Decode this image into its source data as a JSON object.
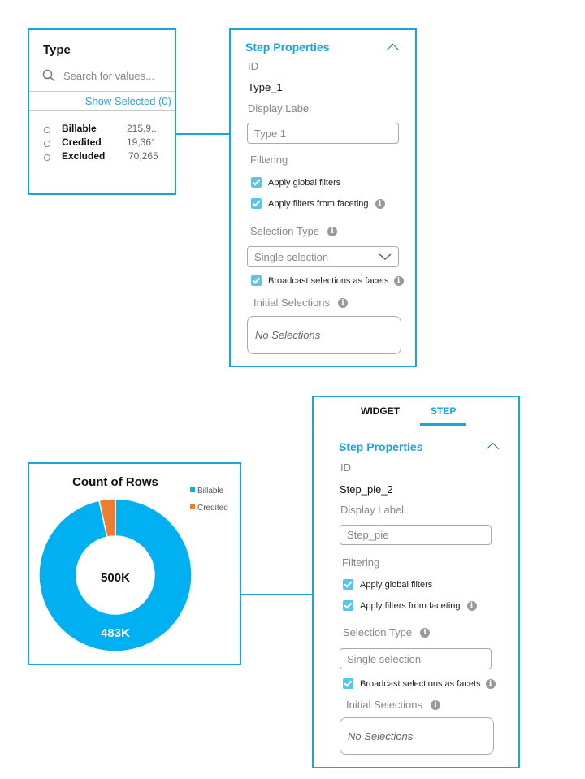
{
  "facet_panel": {
    "title": "Type",
    "search_placeholder": "Search for values...",
    "show_selected": "Show Selected (0)",
    "items": [
      {
        "label": "Billable",
        "count": "215,9..."
      },
      {
        "label": "Credited",
        "count": "19,361"
      },
      {
        "label": "Excluded",
        "count": "70,265"
      }
    ]
  },
  "step_panel_1": {
    "section_title": "Step Properties",
    "id_label": "ID",
    "id_value": "Type_1",
    "display_label_label": "Display Label",
    "display_label_value": "Type 1",
    "filtering_label": "Filtering",
    "apply_global_filters": "Apply global filters",
    "apply_faceting_filters": "Apply filters from faceting",
    "selection_type_label": "Selection Type",
    "selection_type_value": "Single selection",
    "broadcast_label": "Broadcast selections as facets",
    "initial_selections_label": "Initial Selections",
    "initial_selections_value": "No Selections",
    "info_glyph": "i"
  },
  "step_panel_2": {
    "tabs": [
      {
        "label": "WIDGET",
        "active": false
      },
      {
        "label": "STEP",
        "active": true
      }
    ],
    "section_title": "Step Properties",
    "id_label": "ID",
    "id_value": "Step_pie_2",
    "display_label_label": "Display Label",
    "display_label_value": "Step_pie",
    "filtering_label": "Filtering",
    "apply_global_filters": "Apply global filters",
    "apply_faceting_filters": "Apply filters from faceting",
    "selection_type_label": "Selection Type",
    "selection_type_value": "Single selection",
    "broadcast_label": "Broadcast selections as facets",
    "initial_selections_label": "Initial Selections",
    "initial_selections_value": "No Selections",
    "info_glyph": "i"
  },
  "colors": {
    "accent": "#1aa3dd",
    "billable": "#00b0f0",
    "credited": "#ed7d31"
  },
  "chart_data": {
    "type": "pie",
    "title": "Count of Rows",
    "center_label": "500K",
    "total": 500,
    "unit": "K",
    "slices": [
      {
        "name": "Billable",
        "value": 483,
        "label": "483K",
        "color": "#00b0f0"
      },
      {
        "name": "Credited",
        "value": 17,
        "label": "",
        "color": "#ed7d31"
      }
    ],
    "legend": [
      "Billable",
      "Credited"
    ],
    "legend_position": "top-right",
    "donut": true
  }
}
